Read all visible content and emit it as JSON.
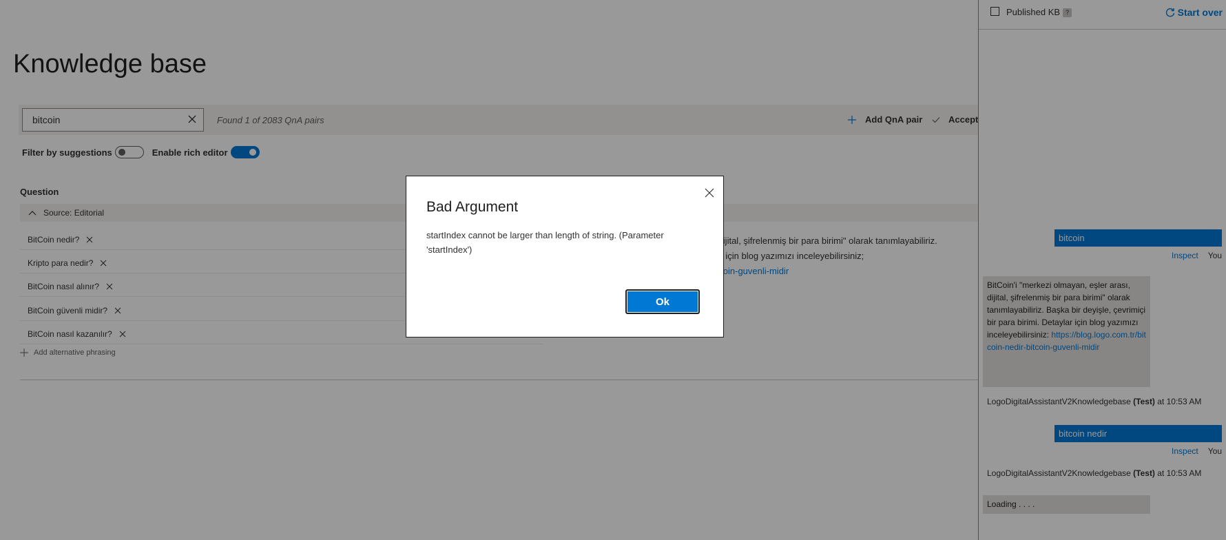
{
  "main": {
    "title": "Knowledge base",
    "search": {
      "value": "bitcoin"
    },
    "found_text": "Found 1 of 2083 QnA pairs",
    "add_qna_label": "Add QnA pair",
    "accept_label": "Accept",
    "filter_label": "Filter by suggestions",
    "rich_editor_label": "Enable rich editor",
    "question_header": "Question",
    "source_label": "Source: Editorial",
    "questions": [
      "BitCoin nedir?",
      "Kripto para nedir?",
      "BitCoin nasıl alınır?",
      "BitCoin güvenli midir?",
      "BitCoin nasıl kazanılır?"
    ],
    "add_alt_label": "Add alternative phrasing",
    "answer_lines": [
      "ası, dijital, şifrelenmiş bir para birimi\" olarak tanımlayabiliriz.",
      "taylar için blog yazımızı inceleyebilirsiniz;",
      "ir-bitcoin-guvenli-midir"
    ]
  },
  "panel": {
    "published_label": "Published KB",
    "help_label": "?",
    "start_over_label": "Start over",
    "inspect_label": "Inspect",
    "you_label": "You",
    "messages": {
      "user1": "bitcoin",
      "bot1_text": "BitCoin'i \"merkezi olmayan, eşler arası, dijital, şifrelenmiş bir para birimi\" olarak tanımlayabiliriz. Başka bir deyişle, çevrimiçi bir para birimi. Detaylar için blog yazımızı inceleyebilirsiniz:",
      "bot1_link": "https://blog.logo.com.tr/bitcoin-nedir-bitcoin-guvenli-midir",
      "bot_name": "LogoDigitalAssistantV2Knowledgebase",
      "test_tag": "(Test)",
      "time": "at 10:53 AM",
      "user2": "bitcoin nedir",
      "loading": "Loading . . . ."
    }
  },
  "dialog": {
    "title": "Bad Argument",
    "body": "startIndex cannot be larger than length of string. (Parameter 'startIndex')",
    "ok_label": "Ok"
  },
  "colors": {
    "accent": "#0078d4",
    "overlay": "rgba(0,0,0,0.4)",
    "chat_bot_bubble": "#e1dfdd"
  }
}
